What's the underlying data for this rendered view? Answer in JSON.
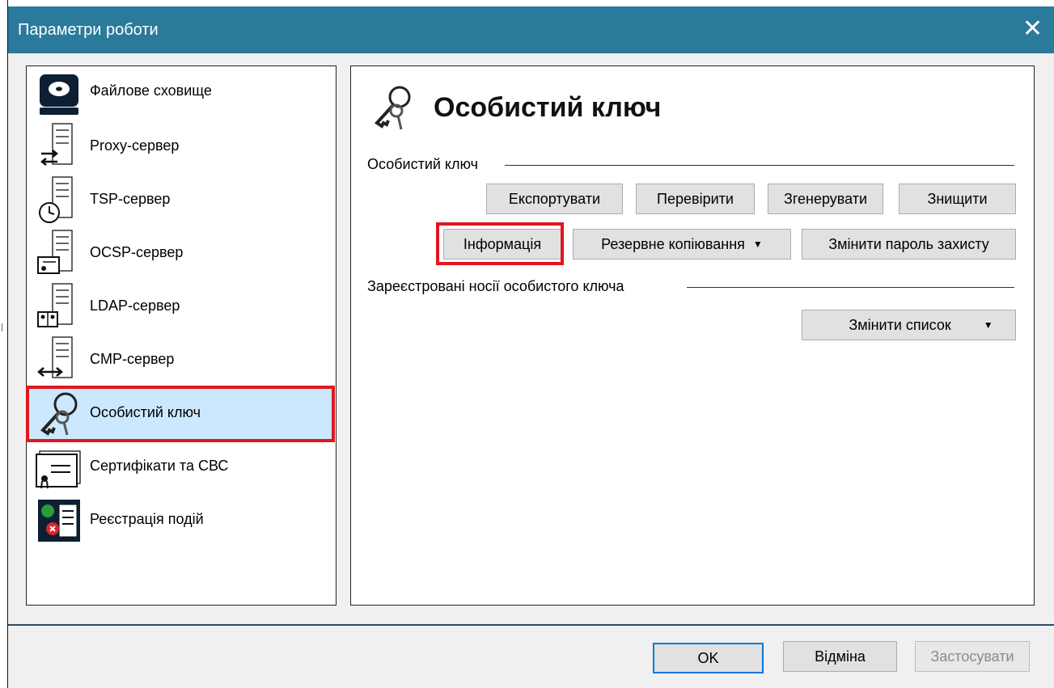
{
  "window": {
    "title": "Параметри роботи",
    "close_glyph": "✕"
  },
  "nav": {
    "items": [
      {
        "label": "Файлове сховище",
        "icon": "disk-storage-icon"
      },
      {
        "label": "Proxy-сервер",
        "icon": "proxy-server-icon"
      },
      {
        "label": "TSP-сервер",
        "icon": "tsp-server-clock-icon"
      },
      {
        "label": "OCSP-сервер",
        "icon": "ocsp-server-certificate-icon"
      },
      {
        "label": "LDAP-сервер",
        "icon": "ldap-server-directory-icon"
      },
      {
        "label": "CMP-сервер",
        "icon": "cmp-server-arrows-icon"
      },
      {
        "label": "Особистий ключ",
        "icon": "private-key-icon",
        "selected": true
      },
      {
        "label": "Сертифікати та СВС",
        "icon": "certificates-icon"
      },
      {
        "label": "Реєстрація подій",
        "icon": "event-log-icon"
      }
    ]
  },
  "content": {
    "heading": "Особистий ключ",
    "heading_icon": "keys-icon",
    "key_section": {
      "label": "Особистий ключ",
      "buttons": {
        "export": "Експортувати",
        "verify": "Перевірити",
        "generate": "Згенерувати",
        "destroy": "Знищити",
        "info": "Інформація",
        "backup": "Резервне копіювання",
        "change_password": "Змінити пароль захисту"
      }
    },
    "media_section": {
      "label": "Зареєстровані носії особистого ключа",
      "change_list": "Змінити список"
    }
  },
  "footer": {
    "ok": "OK",
    "cancel": "Відміна",
    "apply": "Застосувати"
  },
  "colors": {
    "titlebar": "#2b7a9b",
    "highlight": "#e0171f",
    "selected_bg": "#cce8ff",
    "focus": "#0078d7"
  }
}
